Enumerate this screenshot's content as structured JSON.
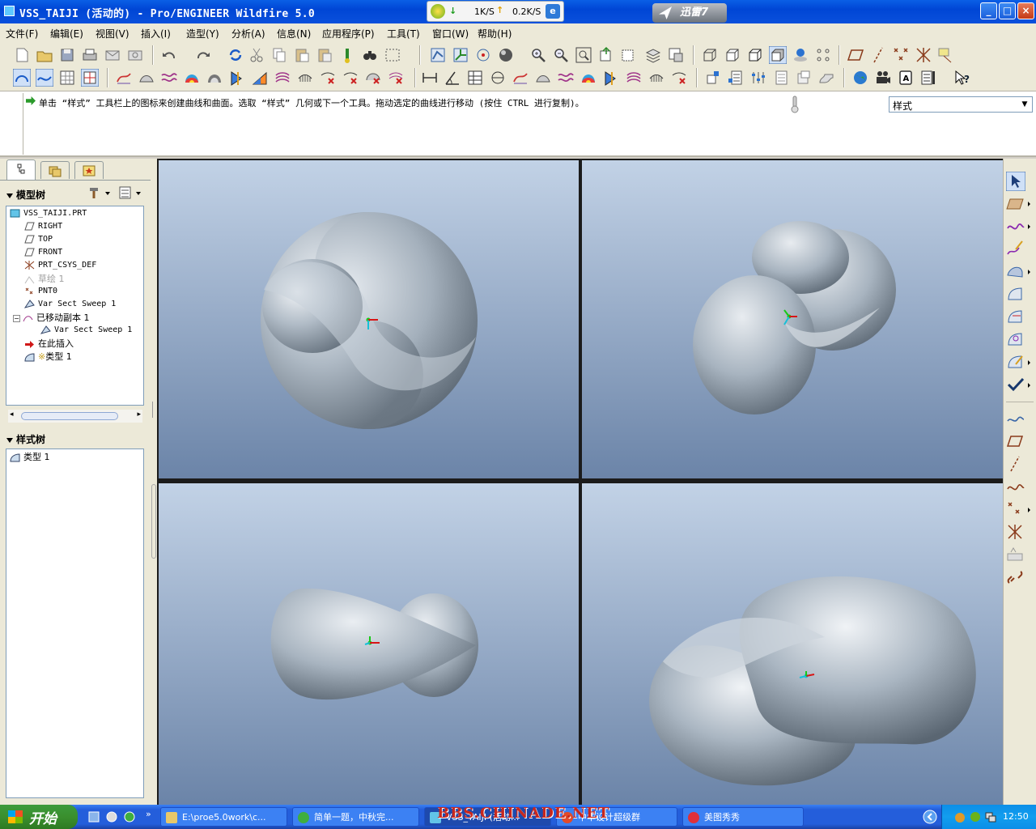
{
  "window": {
    "title": "VSS_TAIJI (活动的) - Pro/ENGINEER Wildfire 5.0",
    "controls": [
      "_",
      "□",
      "×"
    ]
  },
  "xunlei_float": {
    "down": "1K/S",
    "up": "0.2K/S"
  },
  "xunlei_badge": "迅雷7",
  "menu": [
    "文件(F)",
    "编辑(E)",
    "视图(V)",
    "插入(I)",
    "造型(Y)",
    "分析(A)",
    "信息(N)",
    "应用程序(P)",
    "工具(T)",
    "窗口(W)",
    "帮助(H)"
  ],
  "message": "单击 “样式” 工具栏上的图标来创建曲线和曲面。选取 “样式” 几何或下一个工具。拖动选定的曲线进行移动 (按住 CTRL 进行复制)。",
  "style_select": "样式",
  "model_tree": {
    "header": "模型树",
    "items": [
      {
        "label": "VSS_TAIJI.PRT",
        "icon": "part-icon"
      },
      {
        "label": "RIGHT",
        "icon": "datum-plane-icon"
      },
      {
        "label": "TOP",
        "icon": "datum-plane-icon"
      },
      {
        "label": "FRONT",
        "icon": "datum-plane-icon"
      },
      {
        "label": "PRT_CSYS_DEF",
        "icon": "csys-icon"
      },
      {
        "label": "草绘 1",
        "icon": "sketch-icon"
      },
      {
        "label": "PNT0",
        "icon": "datum-point-icon"
      },
      {
        "label": "Var Sect Sweep 1",
        "icon": "sweep-icon"
      },
      {
        "label": "已移动副本 1",
        "icon": "moved-copy-icon"
      },
      {
        "label": "Var Sect Sweep 1",
        "icon": "sweep-icon"
      },
      {
        "label": "在此插入",
        "icon": "insert-here-icon"
      },
      {
        "label": "类型 1",
        "icon": "style-feature-icon"
      }
    ]
  },
  "style_tree": {
    "header": "样式树",
    "items": [
      {
        "label": "类型 1",
        "icon": "style-feature-icon"
      }
    ]
  },
  "taskbar": {
    "start": "开始",
    "tasks": [
      "E:\\proe5.0work\\c...",
      "简单一题，中秋完...",
      "VSS_TAIJI (活动...",
      "中华设计超级群",
      "美图秀秀"
    ],
    "clock": "12:50"
  },
  "watermark": "BBS.CHINADE.NET",
  "colors": {
    "titlebar": "#0054e3",
    "viewport_top": "#c2d2e6",
    "viewport_bottom": "#6b84a8",
    "model": "#a9b6c2"
  }
}
